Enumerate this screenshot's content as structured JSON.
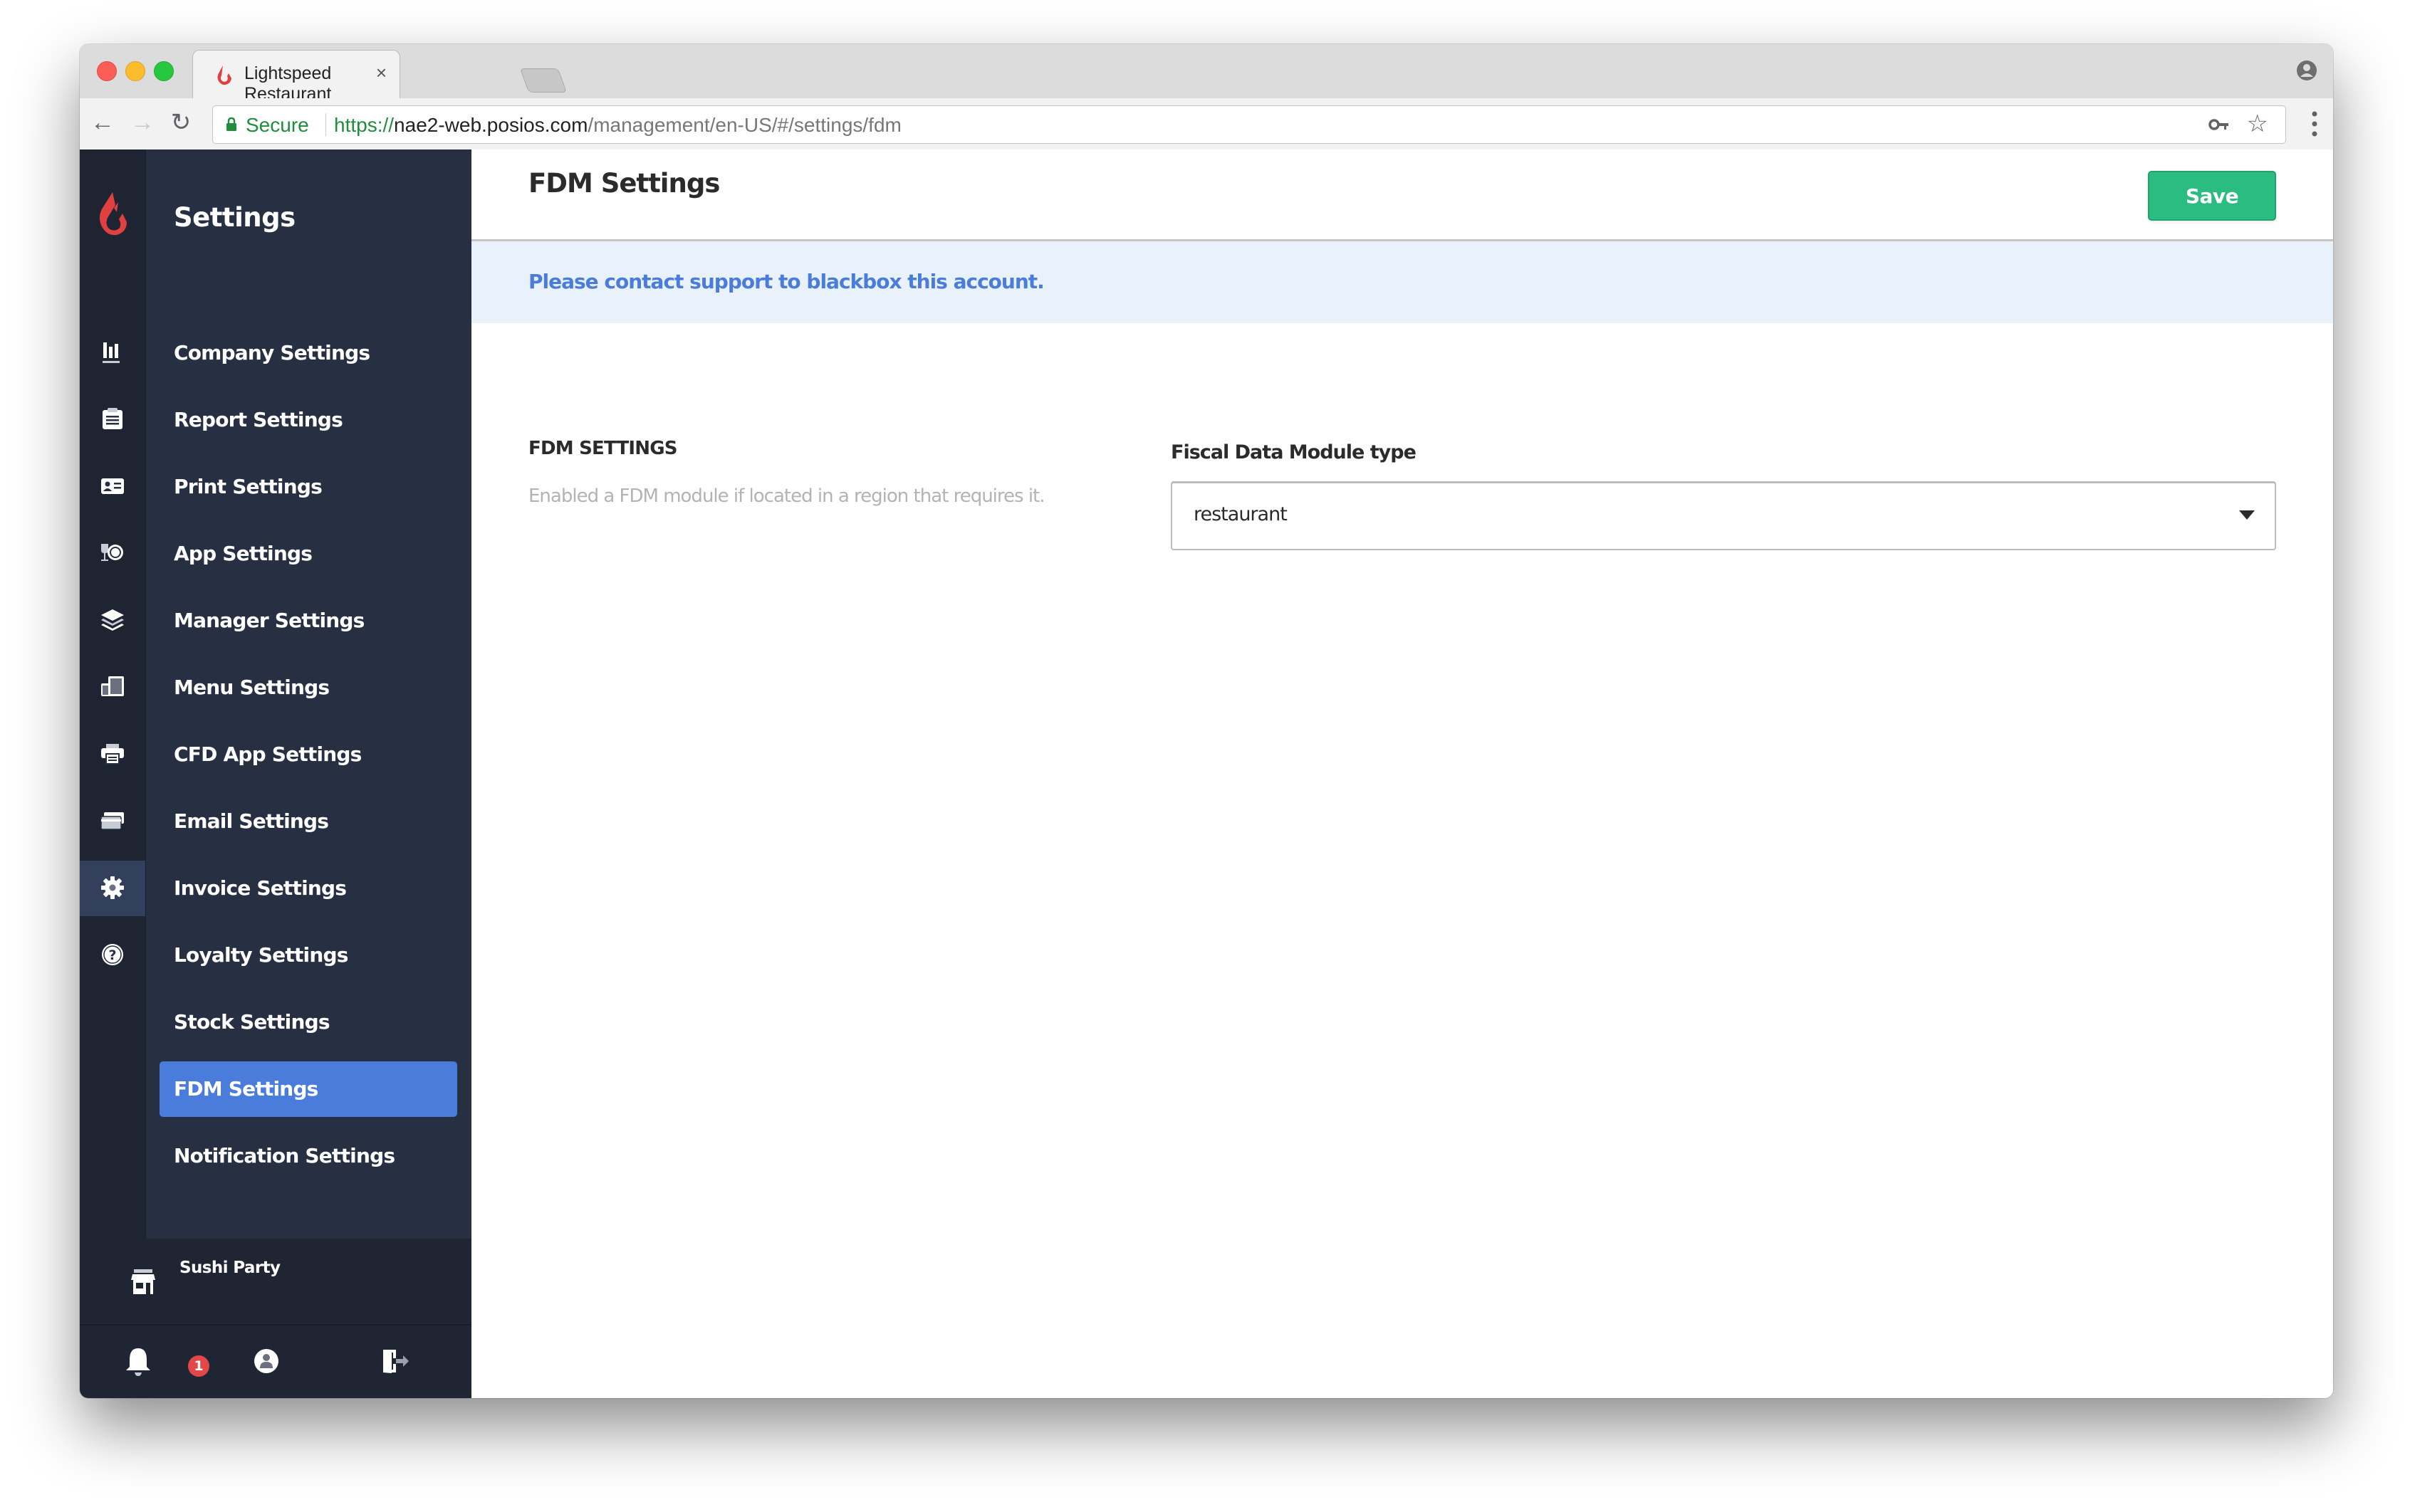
{
  "browser": {
    "tab_title": "Lightspeed Restaurant",
    "tab_close": "×",
    "secure_label": "Secure",
    "url_protocol": "https://",
    "url_host": "nae2-web.posios.com",
    "url_path": "/management/en-US/#/settings/fdm",
    "nav_back": "←",
    "nav_forward": "→",
    "nav_reload": "↻",
    "star": "☆"
  },
  "sidebar": {
    "title": "Settings",
    "items": [
      {
        "label": "Company Settings",
        "icon": "bar-chart-icon"
      },
      {
        "label": "Report Settings",
        "icon": "clipboard-icon"
      },
      {
        "label": "Print Settings",
        "icon": "id-card-icon"
      },
      {
        "label": "App Settings",
        "icon": "glass-plate-icon"
      },
      {
        "label": "Manager Settings",
        "icon": "layers-icon"
      },
      {
        "label": "Menu Settings",
        "icon": "devices-icon"
      },
      {
        "label": "CFD App Settings",
        "icon": "printer-icon"
      },
      {
        "label": "Email Settings",
        "icon": "cards-icon"
      },
      {
        "label": "Invoice Settings",
        "icon": "gear-icon"
      },
      {
        "label": "Loyalty Settings",
        "icon": "help-icon"
      },
      {
        "label": "Stock Settings",
        "icon": ""
      },
      {
        "label": "FDM Settings",
        "icon": "",
        "selected": true
      },
      {
        "label": "Notification Settings",
        "icon": ""
      }
    ],
    "store_name": "Sushi Party",
    "notification_count": "1"
  },
  "colors": {
    "accent": "#4a7cdb",
    "save": "#2abc81",
    "sidebar_bg": "#272f42",
    "brand_red": "#e0403f"
  },
  "main": {
    "page_title": "FDM Settings",
    "save_label": "Save",
    "banner_text": "Please contact support to blackbox this account.",
    "section_title": "FDM SETTINGS",
    "section_description": "Enabled a FDM module if located in a region that requires it.",
    "field_label": "Fiscal Data Module type",
    "select_value": "restaurant"
  }
}
